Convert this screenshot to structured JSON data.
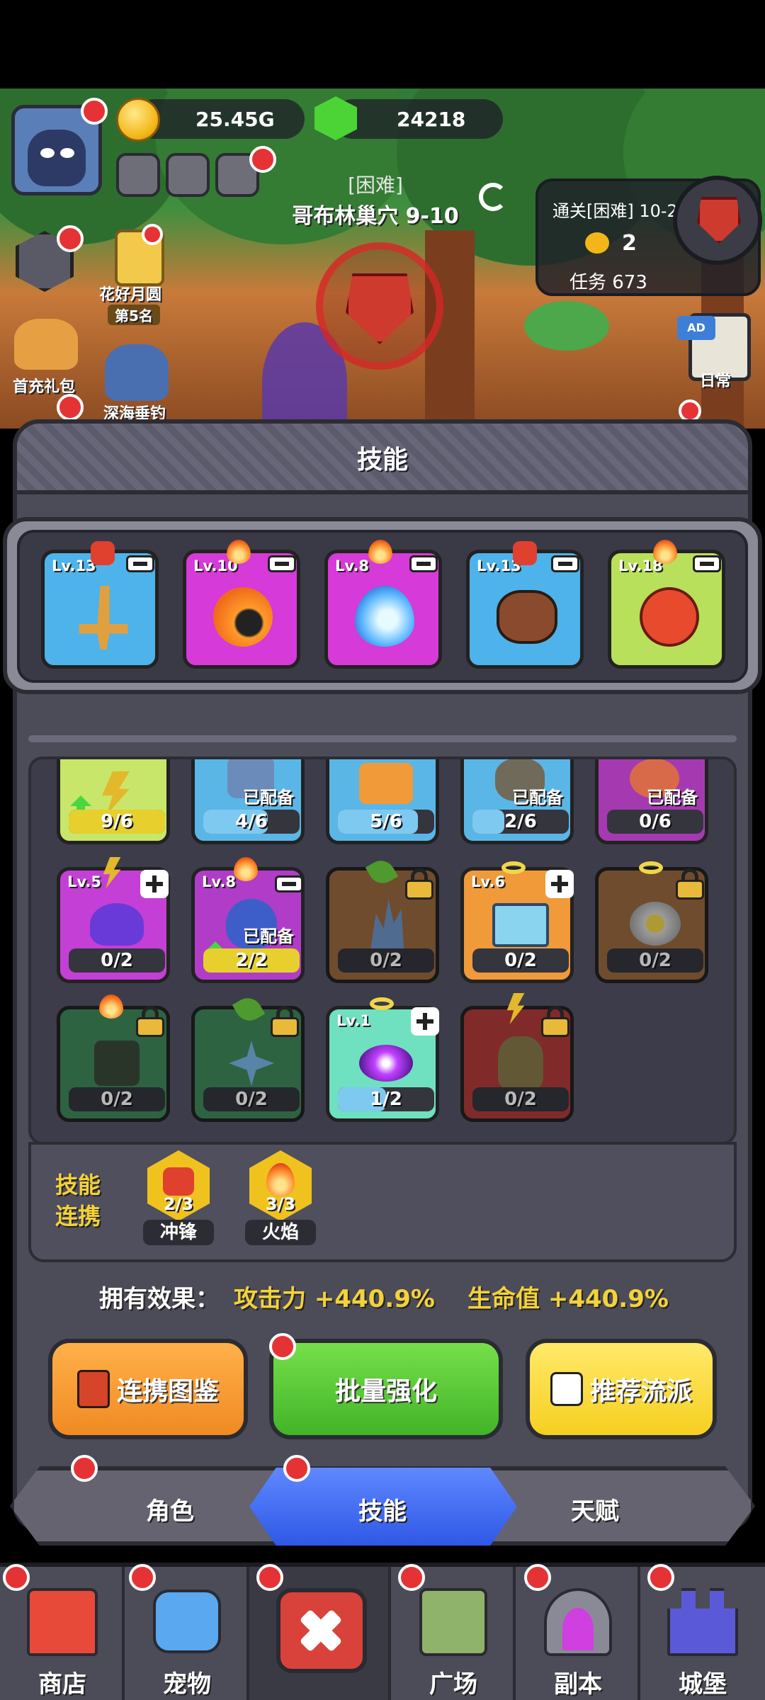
{
  "hud": {
    "gold": "25.45G",
    "gems": "24218",
    "stage_difficulty": "[困难]",
    "stage_name": "哥布林巢穴 9-10",
    "quest_stage": "通关[困难] 10-2",
    "quest_count": "2",
    "quest_task": "任务 673",
    "event_name": "花好月圆",
    "event_rank": "第5名",
    "first_pack": "首充礼包",
    "fishing": "深海垂钓",
    "daily": "日常",
    "ad_tag": "AD"
  },
  "panel": {
    "title": "技能"
  },
  "equipped": [
    {
      "level": "Lv.13",
      "color": "#4db3ea",
      "badge": "fist"
    },
    {
      "level": "Lv.10",
      "color": "#d63ad8",
      "badge": "flame"
    },
    {
      "level": "Lv.8",
      "color": "#d63ad8",
      "badge": "flame"
    },
    {
      "level": "Lv.13",
      "color": "#4db3ea",
      "badge": "fist"
    },
    {
      "level": "Lv.18",
      "color": "#b8e05a",
      "badge": "flame"
    }
  ],
  "skills_row1": [
    {
      "progress": "9/6",
      "equipped": "",
      "color": "#c8e66a",
      "fill": 1.0,
      "bar": "#e7cf2e"
    },
    {
      "progress": "4/6",
      "equipped": "已配备",
      "color": "#5ab6e6",
      "fill": 0.67,
      "bar": "#7ec9f0"
    },
    {
      "progress": "5/6",
      "equipped": "",
      "color": "#5ab6e6",
      "fill": 0.83,
      "bar": "#7ec9f0"
    },
    {
      "progress": "2/6",
      "equipped": "已配备",
      "color": "#5ab6e6",
      "fill": 0.33,
      "bar": "#7ec9f0"
    },
    {
      "progress": "0/6",
      "equipped": "已配备",
      "color": "#a53ab0",
      "fill": 0.0,
      "bar": "#7ec9f0"
    }
  ],
  "skills_row2": [
    {
      "level": "Lv.5",
      "progress": "0/2",
      "equipped": "",
      "color": "#c43fd6",
      "fill": 0.0,
      "bar": "#7ec9f0"
    },
    {
      "level": "Lv.8",
      "progress": "2/2",
      "equipped": "已配备",
      "color": "#b03cc8",
      "fill": 1.0,
      "bar": "#e7cf2e"
    },
    {
      "level": "",
      "progress": "0/2",
      "equipped": "",
      "color": "#9a6a3e",
      "fill": 0.0,
      "bar": "#7ec9f0"
    },
    {
      "level": "Lv.6",
      "progress": "0/2",
      "equipped": "",
      "color": "#f09a3a",
      "fill": 0.0,
      "bar": "#7ec9f0"
    },
    {
      "level": "",
      "progress": "0/2",
      "equipped": "",
      "color": "#9a6a3e",
      "fill": 0.0,
      "bar": "#7ec9f0"
    }
  ],
  "skills_row3": [
    {
      "level": "",
      "progress": "0/2",
      "color": "#3f8a5a",
      "fill": 0.0,
      "bar": "#7ec9f0"
    },
    {
      "level": "",
      "progress": "0/2",
      "color": "#3f8a5a",
      "fill": 0.0,
      "bar": "#7ec9f0"
    },
    {
      "level": "Lv.1",
      "progress": "1/2",
      "color": "#6fe0c0",
      "fill": 0.5,
      "bar": "#7ec9f0"
    },
    {
      "level": "",
      "progress": "0/2",
      "color": "#b33a3a",
      "fill": 0.0,
      "bar": "#7ec9f0"
    }
  ],
  "link": {
    "label_line1": "技能",
    "label_line2": "连携",
    "items": [
      {
        "count": "2/3",
        "name": "冲锋"
      },
      {
        "count": "3/3",
        "name": "火焰"
      }
    ]
  },
  "effect": {
    "label": "拥有效果：",
    "attack": "攻击力 +440.9%",
    "hp": "生命值 +440.9%"
  },
  "buttons": {
    "collection": "连携图鉴",
    "batch_upgrade": "批量强化",
    "recommend": "推荐流派"
  },
  "tabs": {
    "character": "角色",
    "skill": "技能",
    "talent": "天赋"
  },
  "nav": {
    "shop": "商店",
    "pet": "宠物",
    "plaza": "广场",
    "dungeon": "副本",
    "castle": "城堡"
  }
}
